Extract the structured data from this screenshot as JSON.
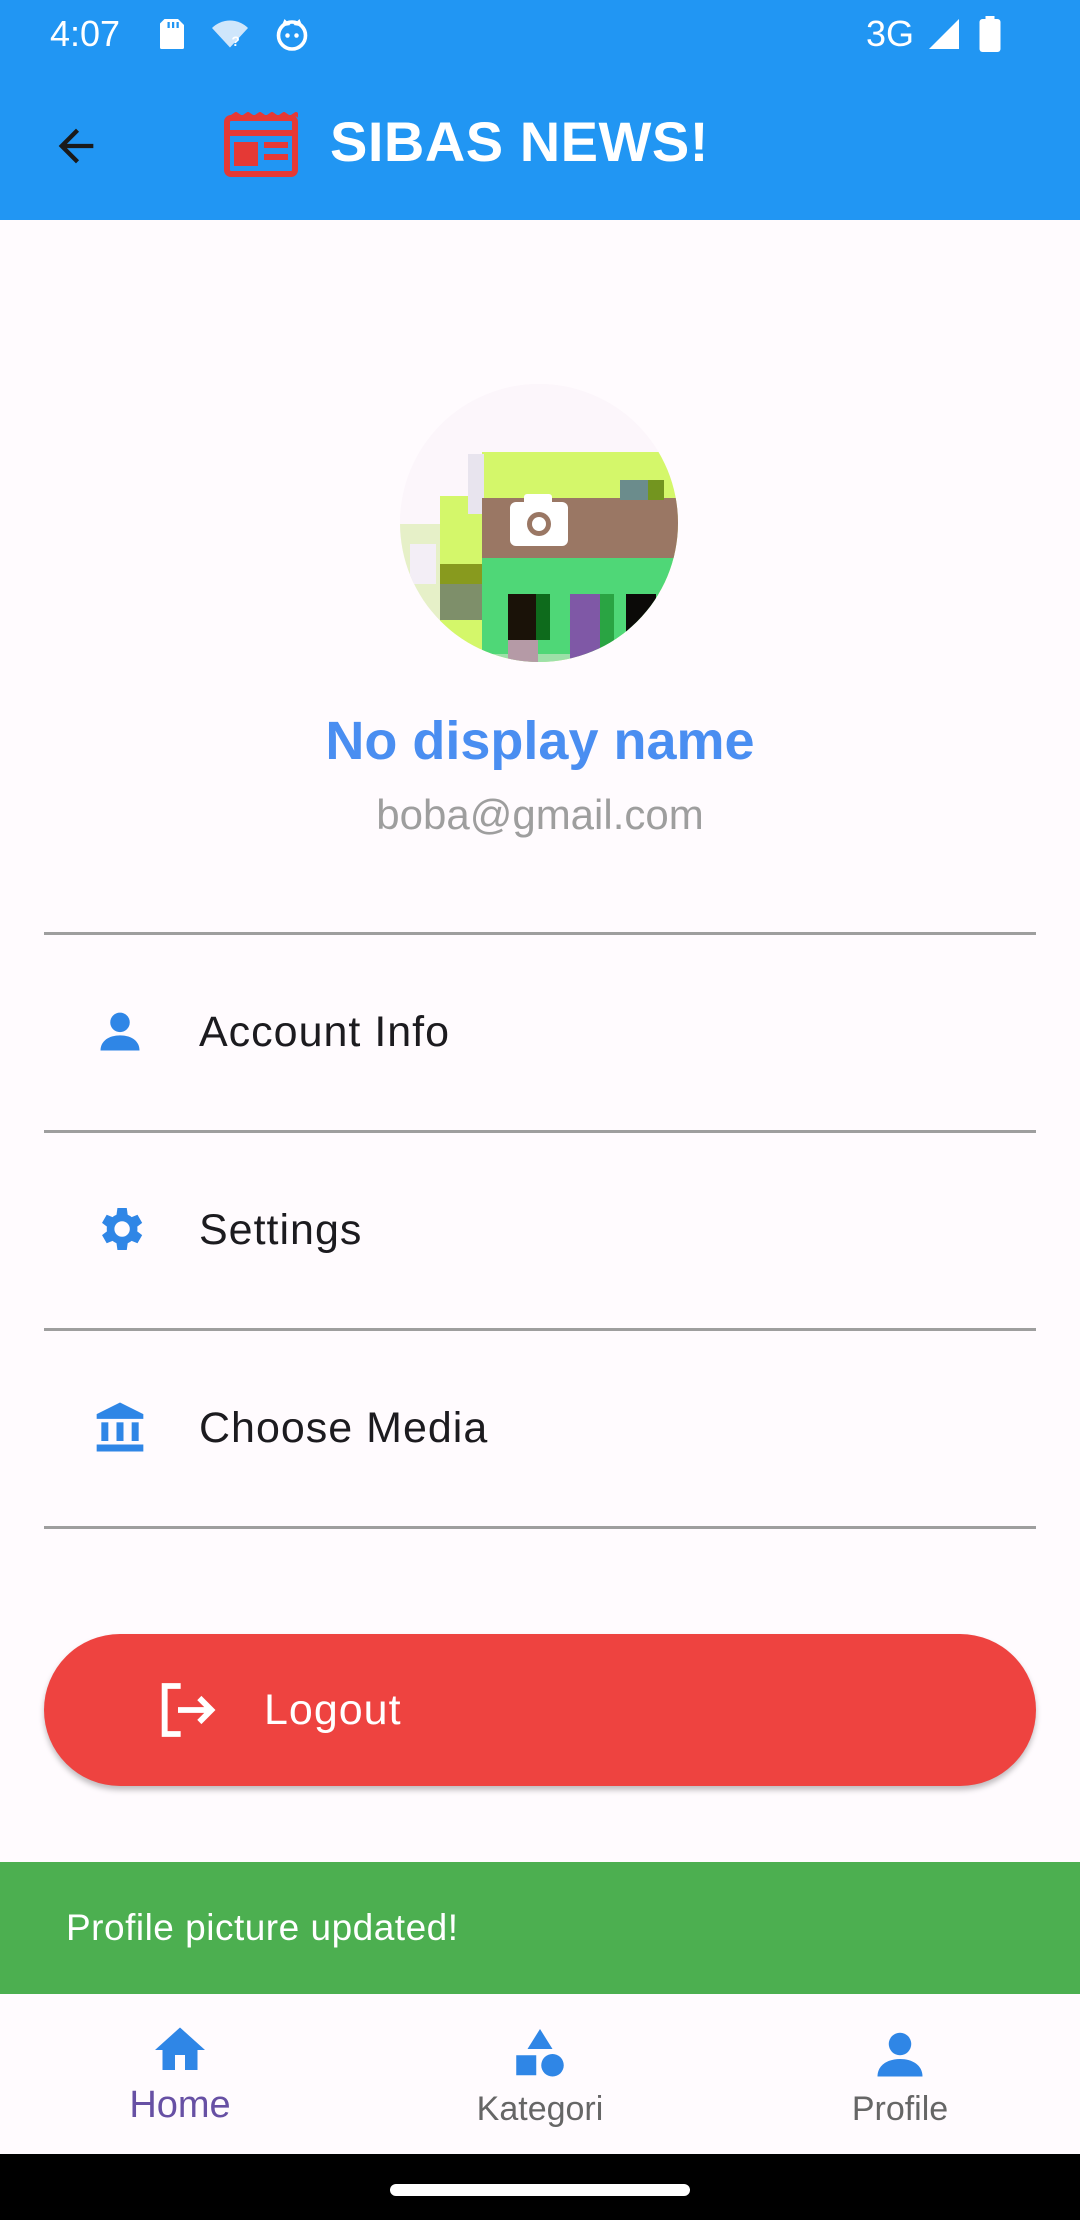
{
  "status_bar": {
    "time": "4:07",
    "network": "3G",
    "icons": [
      "sd-card-icon",
      "wifi-unknown-icon",
      "cat-app-icon",
      "cell-signal-icon",
      "battery-icon"
    ]
  },
  "app_bar": {
    "title": "SIBAS NEWS!",
    "back_icon": "arrow-back-icon",
    "logo_icon": "newspaper-icon",
    "colors": {
      "background": "#2196f3",
      "logo": "#e53935"
    }
  },
  "profile": {
    "display_name": "No display name",
    "email": "boba@gmail.com",
    "avatar_overlay_icon": "camera-icon"
  },
  "menu": {
    "items": [
      {
        "label": "Account Info",
        "icon": "person-icon"
      },
      {
        "label": "Settings",
        "icon": "gear-icon"
      },
      {
        "label": "Choose Media",
        "icon": "bank-icon"
      }
    ]
  },
  "logout": {
    "label": "Logout",
    "icon": "logout-icon",
    "color": "#ee4340"
  },
  "snackbar": {
    "message": "Profile picture updated!",
    "color": "#4caf50"
  },
  "bottom_nav": {
    "items": [
      {
        "label": "Home",
        "icon": "home-icon",
        "active": true
      },
      {
        "label": "Kategori",
        "icon": "category-shapes-icon",
        "active": false
      },
      {
        "label": "Profile",
        "icon": "person-icon",
        "active": false
      }
    ]
  },
  "colors": {
    "accent": "#4a8ef1",
    "icon_blue": "#2f86e6",
    "active_nav": "#6750a4"
  }
}
